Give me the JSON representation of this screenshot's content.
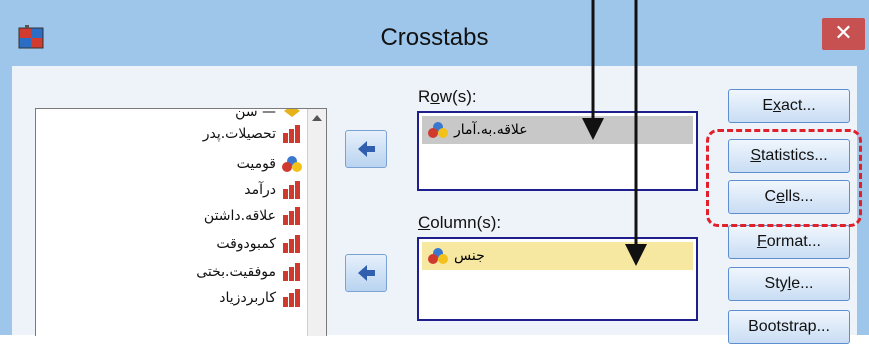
{
  "window": {
    "title": "Crosstabs",
    "close_symbol": "✕"
  },
  "variables": [
    {
      "label": "— سن",
      "type": "scale",
      "partial": true
    },
    {
      "label": "تحصیلات.پدر",
      "type": "ordinal"
    },
    {
      "label": "قومیت",
      "type": "nominal"
    },
    {
      "label": "درآمد",
      "type": "ordinal"
    },
    {
      "label": "علاقه.داشتن",
      "type": "ordinal"
    },
    {
      "label": "کمبودوقت",
      "type": "ordinal"
    },
    {
      "label": "موفقیت.بختی",
      "type": "ordinal"
    },
    {
      "label": "کاربردزیاد",
      "type": "ordinal"
    }
  ],
  "rows": {
    "label_prefix": "R",
    "label_underlined": "o",
    "label_suffix": "w(s):",
    "item": "علاقه.به.آمار"
  },
  "columns": {
    "label_underlined": "C",
    "label_suffix": "olumn(s):",
    "item": "جنس"
  },
  "buttons": {
    "exact": {
      "pre": "E",
      "u": "x",
      "post": "act..."
    },
    "statistics": {
      "pre": "",
      "u": "S",
      "post": "tatistics..."
    },
    "cells": {
      "pre": "C",
      "u": "e",
      "post": "lls..."
    },
    "format": {
      "pre": "",
      "u": "F",
      "post": "ormat..."
    },
    "style": {
      "pre": "Sty",
      "u": "l",
      "post": "e..."
    },
    "bootstrap": {
      "pre": "Bootstrap...",
      "u": "",
      "post": ""
    }
  },
  "colors": {
    "titlebar": "#9ec6ea",
    "selected_row_bg": "#c8c8c8",
    "selected_col_bg": "#f6e8a0",
    "highlight_dash": "#e0202a",
    "arrow": "#111111"
  },
  "icons": {
    "app": "crosstabs-app-icon",
    "ordinal": "ordinal-bar-icon",
    "nominal": "nominal-balls-icon",
    "move": "left-arrow-icon"
  }
}
